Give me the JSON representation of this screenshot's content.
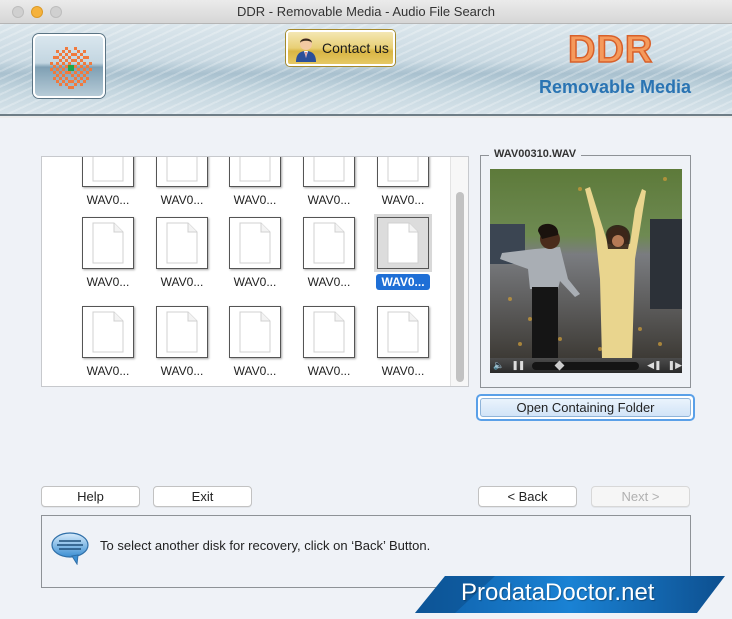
{
  "window": {
    "title": "DDR - Removable Media - Audio File Search"
  },
  "header": {
    "contact_label": "Contact us",
    "brand_title": "DDR",
    "brand_subtitle": "Removable Media",
    "logo_icon": "checker-sun-logo-icon",
    "contact_icon": "businessman-icon"
  },
  "file_grid": {
    "rows": [
      {
        "partial": true,
        "items": [
          {
            "label": "WAV0...",
            "selected": false
          },
          {
            "label": "WAV0...",
            "selected": false
          },
          {
            "label": "WAV0...",
            "selected": false
          },
          {
            "label": "WAV0...",
            "selected": false
          },
          {
            "label": "WAV0...",
            "selected": false
          }
        ]
      },
      {
        "partial": false,
        "items": [
          {
            "label": "WAV0...",
            "selected": false
          },
          {
            "label": "WAV0...",
            "selected": false
          },
          {
            "label": "WAV0...",
            "selected": false
          },
          {
            "label": "WAV0...",
            "selected": false
          },
          {
            "label": "WAV0...",
            "selected": true
          }
        ]
      },
      {
        "partial": false,
        "items": [
          {
            "label": "WAV0...",
            "selected": false
          },
          {
            "label": "WAV0...",
            "selected": false
          },
          {
            "label": "WAV0...",
            "selected": false
          },
          {
            "label": "WAV0...",
            "selected": false
          },
          {
            "label": "WAV0...",
            "selected": false
          }
        ]
      }
    ],
    "file_icon": "blank-document-icon"
  },
  "preview": {
    "filename": "WAV00310.WAV",
    "image_description": "Two girls jumping joyfully on a leaf-covered street",
    "player": {
      "volume_icon": "speaker-icon",
      "pause_icon": "pause-icon",
      "prev_icon": "step-back-icon",
      "next_icon": "step-forward-icon",
      "progress": 0.2
    }
  },
  "buttons": {
    "open_folder": "Open Containing Folder",
    "help": "Help",
    "exit": "Exit",
    "back": "< Back",
    "next": "Next >"
  },
  "status": {
    "icon": "speech-bubble-icon",
    "message": "To select another disk for recovery, click on ‘Back’ Button."
  },
  "promo": {
    "text": "ProdataDoctor.net"
  },
  "colors": {
    "brand_orange": "#f59a5c",
    "brand_blue": "#2a74b3",
    "selection_blue": "#1f6fd6",
    "promo_blue": "#1a78c8"
  }
}
